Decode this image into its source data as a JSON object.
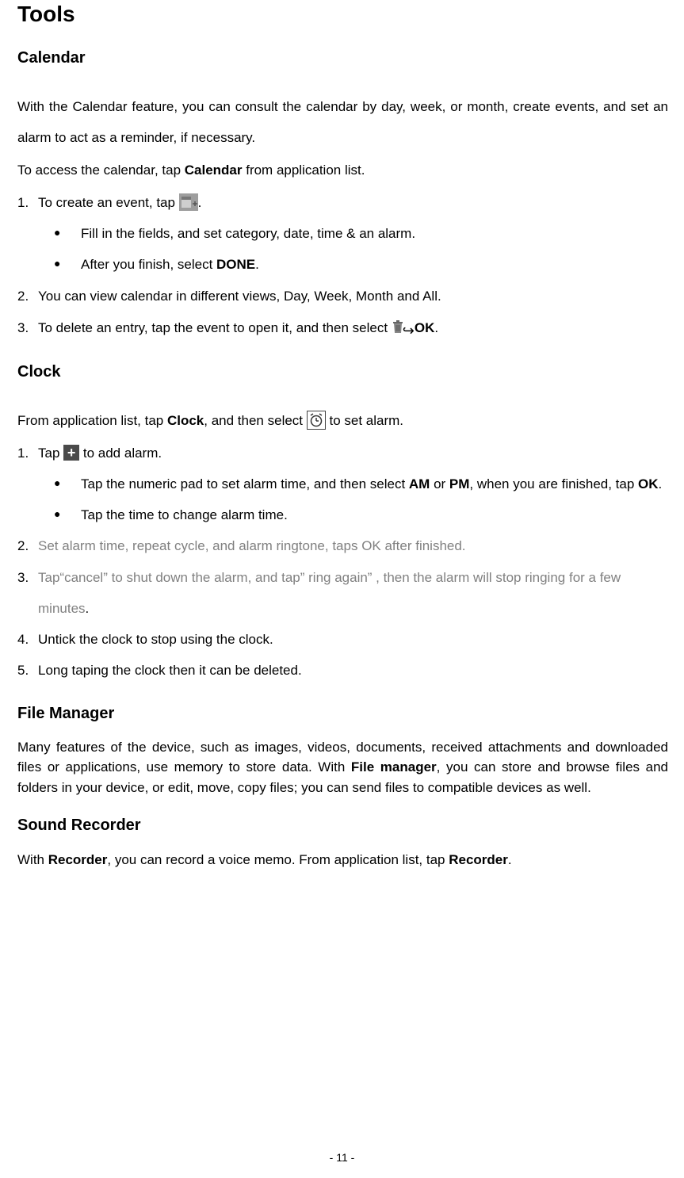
{
  "h1": "Tools",
  "calendar": {
    "heading": "Calendar",
    "p1": "With the Calendar feature, you can consult the calendar by day, week, or month, create events, and set an alarm to act as a reminder, if necessary.",
    "p2a": "To access the calendar, tap ",
    "p2b": "Calendar",
    "p2c": " from application list.",
    "li1": "To create an event, tap ",
    "b1": "Fill in the fields, and set category, date, time & an alarm.",
    "b2a": "After you finish, select ",
    "b2b": "DONE",
    "li2": "You can view calendar in different views, Day, Week, Month and All.",
    "li3a": "To delete an entry, tap the event to open it, and then select ",
    "li3b": "OK"
  },
  "clock": {
    "heading": "Clock",
    "p1a": "From application list, tap ",
    "p1b": "Clock",
    "p1c": ", and then select ",
    "p1d": " to set alarm.",
    "li1a": "Tap ",
    "li1b": " to add alarm.",
    "b1a": "Tap the numeric pad to set alarm time, and then select ",
    "b1b": "AM",
    "b1c": " or ",
    "b1d": "PM",
    "b1e": ", when you are finished, tap ",
    "b1f": "OK",
    "b2": "Tap the time to change alarm time.",
    "li2": "Set alarm time, repeat cycle, and alarm ringtone, taps OK after finished.",
    "li3": "Tap“cancel” to shut down the alarm, and tap” ring again” , then the alarm will stop ringing for a few minutes",
    "li4": "Untick the clock to stop using the clock.",
    "li5": "Long taping the clock then it can be deleted."
  },
  "fm": {
    "heading": "File Manager",
    "p1a": "Many features of the device, such as images, videos, documents, received attachments and downloaded files or applications, use memory to store data. With ",
    "p1b": "File manager",
    "p1c": ", you can store and browse files and folders in your device, or edit, move, copy files; you can send files to compatible devices as well."
  },
  "sr": {
    "heading": "Sound Recorder",
    "p1a": "With ",
    "p1b": "Recorder",
    "p1c": ", you can record a voice memo. From application list, tap ",
    "p1d": "Recorder"
  },
  "footer": "- 11 -",
  "nums": {
    "n1": "1.",
    "n2": "2.",
    "n3": "3.",
    "n4": "4.",
    "n5": "5."
  },
  "dot": "●",
  "period": ".",
  "arrow": "↪"
}
